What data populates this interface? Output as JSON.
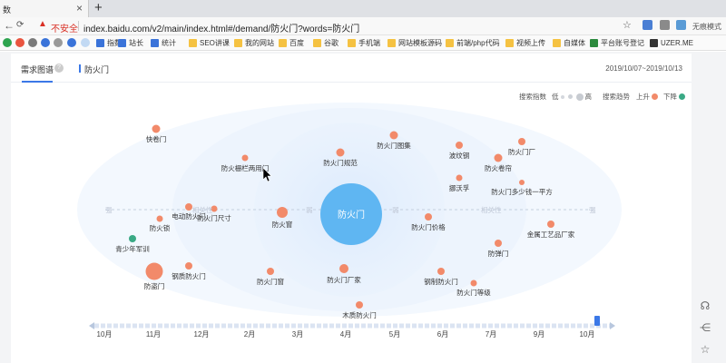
{
  "browser": {
    "tab_title": "数",
    "tab_close": "×",
    "new_tab": "+",
    "back": "←",
    "forward": "→",
    "reload": "C",
    "insecure_label": "不安全",
    "url": "index.baidu.com/v2/main/index.html#/demand/防火门?words=防火门",
    "trace_label": "无痕模式"
  },
  "bookmarks": [
    {
      "label": "指数",
      "icon": "paw-icon"
    },
    {
      "label": "站长",
      "icon": "paw-icon"
    },
    {
      "label": "统计",
      "icon": "chart-icon"
    },
    {
      "label": "SEO讲课",
      "icon": "folder-icon"
    },
    {
      "label": "我的网站",
      "icon": "folder-icon"
    },
    {
      "label": "百度",
      "icon": "folder-icon"
    },
    {
      "label": "谷歌",
      "icon": "folder-icon"
    },
    {
      "label": "手机端",
      "icon": "folder-icon"
    },
    {
      "label": "网站模板源码",
      "icon": "folder-icon"
    },
    {
      "label": "前端/php代码",
      "icon": "folder-icon"
    },
    {
      "label": "视频上传",
      "icon": "folder-icon"
    },
    {
      "label": "自媒体",
      "icon": "folder-icon"
    },
    {
      "label": "平台账号登记",
      "icon": "folder-icon"
    },
    {
      "label": "UZER.ME",
      "icon": "uzer-icon"
    }
  ],
  "page": {
    "tab_main": "需求图谱",
    "help": "?",
    "keyword": "防火门",
    "date_range": "2019/10/07~2019/10/13",
    "legend": {
      "index_label": "搜索指数",
      "low": "低",
      "high": "高",
      "trend_label": "搜索趋势",
      "up": "上升",
      "down": "下降"
    },
    "colors": {
      "up": "#f28a6a",
      "down": "#3aa985",
      "center": "#5fb6f2",
      "accent": "#3b78e7"
    }
  },
  "chart_data": {
    "type": "network",
    "center": "防火门",
    "axis_tags": {
      "left_far": "强",
      "left": "相关性",
      "left_near": "弱",
      "right_near": "弱",
      "right": "相关性",
      "right_far": "强"
    },
    "nodes": [
      {
        "label": "快卷门",
        "trend": "up"
      },
      {
        "label": "防火栅栏两用门",
        "trend": "up"
      },
      {
        "label": "防火门规范",
        "trend": "up"
      },
      {
        "label": "防火门图集",
        "trend": "up"
      },
      {
        "label": "波纹钢",
        "trend": "up"
      },
      {
        "label": "防火门厂",
        "trend": "up"
      },
      {
        "label": "防火卷帘",
        "trend": "up"
      },
      {
        "label": "防火门多少钱一平方",
        "trend": "up"
      },
      {
        "label": "挪沃孚",
        "trend": "up"
      },
      {
        "label": "电动防火门",
        "trend": "up"
      },
      {
        "label": "防火门尺寸",
        "trend": "up"
      },
      {
        "label": "防火窗",
        "trend": "up"
      },
      {
        "label": "防火锁",
        "trend": "up"
      },
      {
        "label": "防火门价格",
        "trend": "up"
      },
      {
        "label": "金属工艺品厂家",
        "trend": "up"
      },
      {
        "label": "青少年军训",
        "trend": "down"
      },
      {
        "label": "防弹门",
        "trend": "up"
      },
      {
        "label": "钢质防火门",
        "trend": "up"
      },
      {
        "label": "防盗门",
        "trend": "up"
      },
      {
        "label": "防火门窗",
        "trend": "up"
      },
      {
        "label": "防火门厂家",
        "trend": "up"
      },
      {
        "label": "钢制防火门",
        "trend": "up"
      },
      {
        "label": "防火门等级",
        "trend": "up"
      },
      {
        "label": "木质防火门",
        "trend": "up"
      }
    ],
    "timeline": [
      "10月",
      "11月",
      "12月",
      "2月",
      "3月",
      "4月",
      "5月",
      "6月",
      "7月",
      "9月",
      "10月"
    ]
  }
}
